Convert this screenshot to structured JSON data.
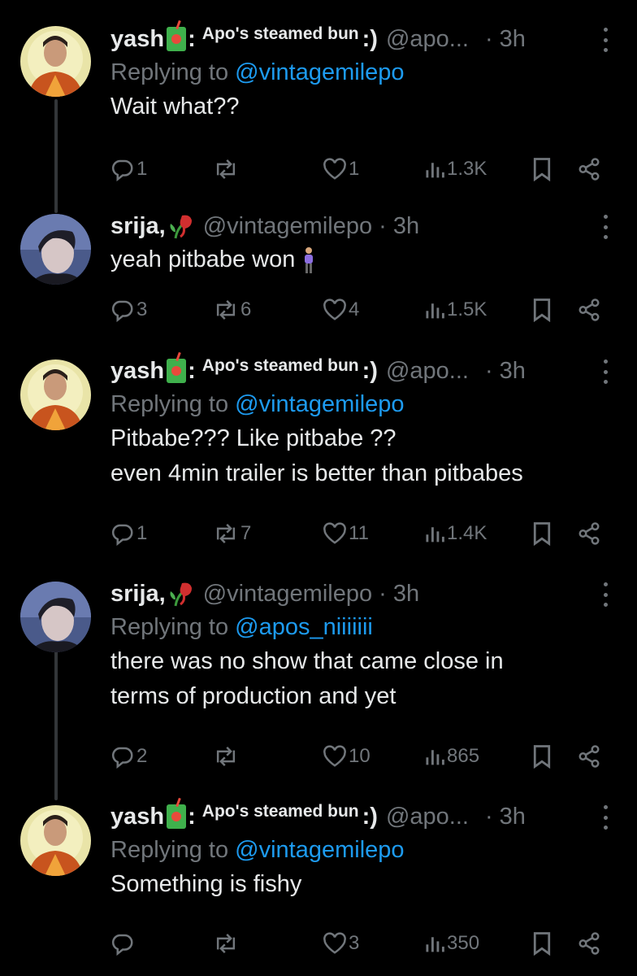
{
  "thread": [
    {
      "user": "yash",
      "name_extra": "Apo's steamed bun",
      "name_smile": ":)",
      "handle": "@apo...",
      "time": "· 3h",
      "avatar": "yash",
      "replying_prefix": "Replying to ",
      "replying_to": "@vintagemilepo",
      "lines": [
        "Wait what??"
      ],
      "replies": "1",
      "reposts": "",
      "likes": "1",
      "views": "1.3K"
    },
    {
      "user": "srija,",
      "handle": "@vintagemilepo",
      "time": "· 3h",
      "avatar": "srija",
      "lines": [
        "yeah pitbabe won"
      ],
      "replies": "3",
      "reposts": "6",
      "likes": "4",
      "views": "1.5K"
    },
    {
      "user": "yash",
      "name_extra": "Apo's steamed bun",
      "name_smile": ":)",
      "handle": "@apo...",
      "time": "· 3h",
      "avatar": "yash",
      "replying_prefix": "Replying to ",
      "replying_to": "@vintagemilepo",
      "lines": [
        "Pitbabe??? Like pitbabe ??",
        "even 4min trailer is better than pitbabes"
      ],
      "replies": "1",
      "reposts": "7",
      "likes": "11",
      "views": "1.4K"
    },
    {
      "user": "srija,",
      "handle": "@vintagemilepo",
      "time": "· 3h",
      "avatar": "srija",
      "replying_prefix": "Replying to ",
      "replying_to": "@apos_niiiiiii",
      "lines": [
        "there was no show that came close in",
        "terms of production and yet"
      ],
      "replies": "2",
      "reposts": "",
      "likes": "10",
      "views": "865"
    },
    {
      "user": "yash",
      "name_extra": "Apo's steamed bun",
      "name_smile": ":)",
      "handle": "@apo...",
      "time": "· 3h",
      "avatar": "yash",
      "replying_prefix": "Replying to ",
      "replying_to": "@vintagemilepo",
      "lines": [
        "Something is fishy"
      ],
      "replies": "",
      "reposts": "",
      "likes": "3",
      "views": "350"
    }
  ],
  "icons": {
    "reply": "reply-icon",
    "repost": "repost-icon",
    "like": "heart-icon",
    "views": "views-icon",
    "bookmark": "bookmark-icon",
    "share": "share-icon",
    "more": "more-icon"
  },
  "colors": {
    "background": "#000000",
    "text": "#e7e9ea",
    "muted": "#71767b",
    "link": "#1d9bf0",
    "thread_line": "#333639"
  }
}
